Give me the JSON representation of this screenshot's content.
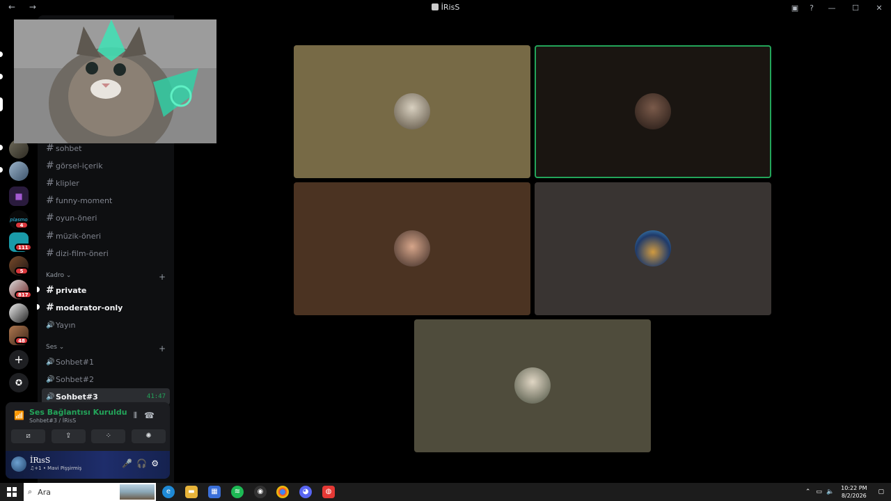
{
  "window": {
    "title": "İRisS",
    "nav": "← →",
    "inbox_icon": "inbox-icon",
    "help_icon": "help-icon",
    "controls": [
      "—",
      "☐",
      "✕"
    ]
  },
  "servers": [
    {
      "badge": "4",
      "label": "plasmo"
    },
    {
      "badge": "111"
    },
    {
      "badge": "5"
    },
    {
      "badge": "817"
    },
    {
      "badge": ""
    },
    {
      "badge": "48"
    }
  ],
  "server_actions": {
    "add": "+",
    "explore": "✪"
  },
  "channels": {
    "text": [
      {
        "name": "sohbet"
      },
      {
        "name": "görsel-içerik"
      },
      {
        "name": "klipler"
      },
      {
        "name": "funny-moment"
      },
      {
        "name": "oyun-öneri"
      },
      {
        "name": "müzik-öneri"
      },
      {
        "name": "dizi-film-öneri"
      }
    ],
    "categories": [
      {
        "name": "Kadro ⌄",
        "plus": "+"
      },
      {
        "name": "Ses ⌄",
        "plus": "+"
      }
    ],
    "kadro": [
      {
        "name": "private",
        "icon": "#"
      },
      {
        "name": "moderator-only",
        "icon": "#"
      },
      {
        "name": "Yayın",
        "icon": "🔊"
      }
    ],
    "ses": [
      {
        "name": "Sohbet#1"
      },
      {
        "name": "Sohbet#2"
      },
      {
        "name": "Sohbet#3",
        "time": "41:47"
      }
    ]
  },
  "voice": {
    "status": "Ses Bağlantısı Kuruldu",
    "location": "Sohbet#3 / İRisS",
    "buttons": [
      "⧄",
      "⇪",
      "⁘",
      "✺"
    ]
  },
  "user": {
    "name": "İRısS",
    "status": "♫+1 • Mavi Pişşirmiş"
  },
  "taskbar": {
    "search_placeholder": "Ara",
    "time": "10:22 PM",
    "date": "8/2/2026"
  },
  "colors": {
    "tile1": "#776a46",
    "tile2": "#1a1511",
    "tile3": "#4b3322",
    "tile4": "#393432",
    "tile5": "#4f4c3c",
    "speaking": "#23a55a"
  }
}
